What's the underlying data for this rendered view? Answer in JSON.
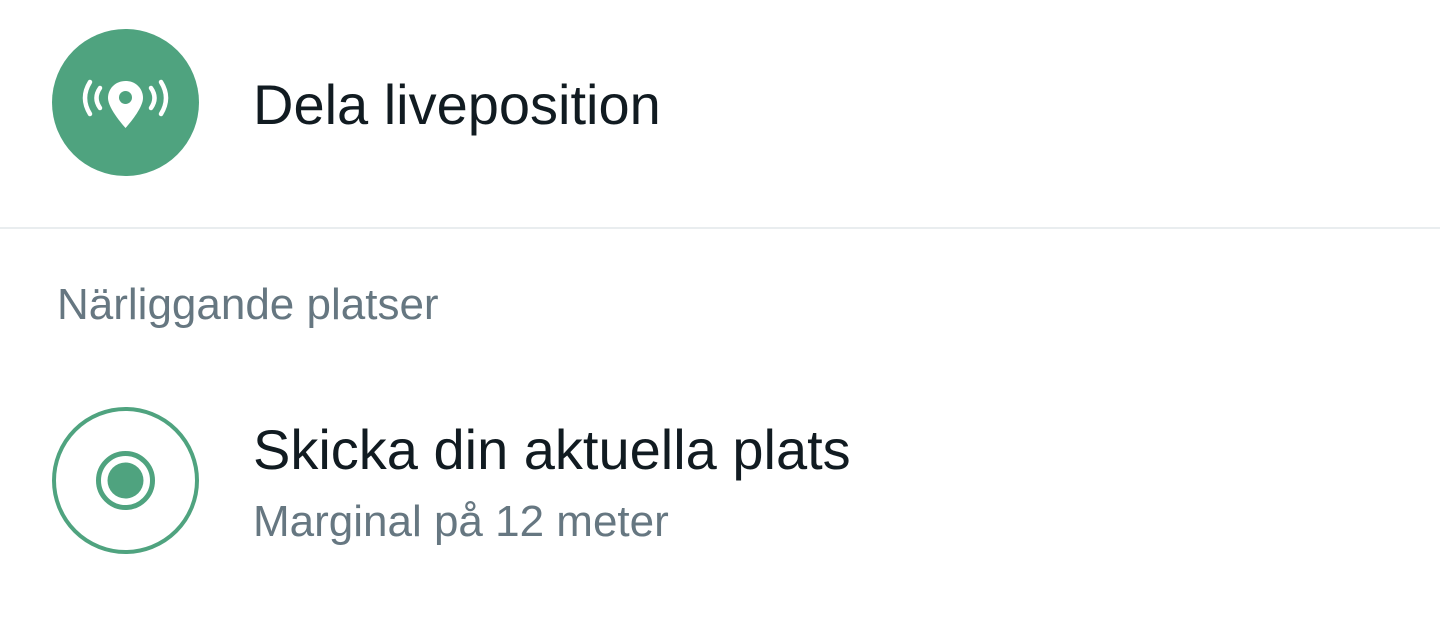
{
  "share_live": {
    "label": "Dela liveposition",
    "icon": "live-location-icon",
    "icon_bg_color": "#4fa37f"
  },
  "nearby": {
    "section_title": "Närliggande platser"
  },
  "current_location": {
    "title": "Skicka din aktuella plats",
    "accuracy_text": "Marginal på 12 meter",
    "icon": "current-location-icon",
    "accent_color": "#4fa37f"
  }
}
